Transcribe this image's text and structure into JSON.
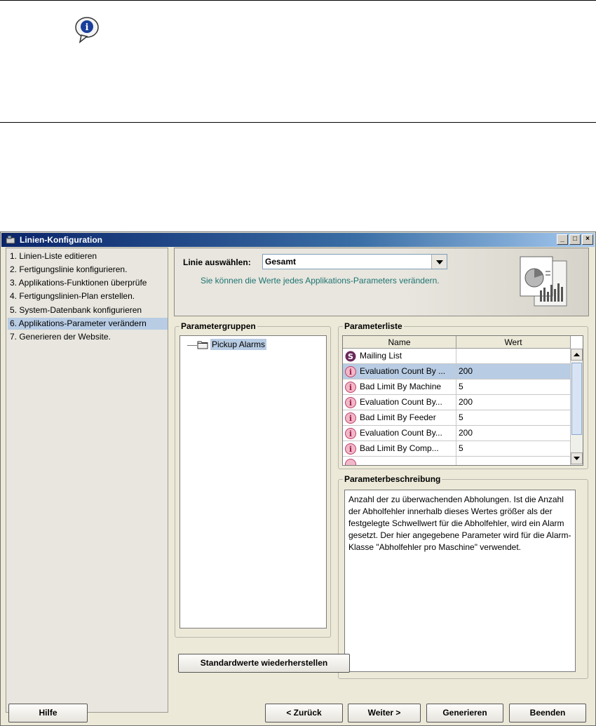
{
  "window": {
    "title": "Linien-Konfiguration",
    "minimize": "_",
    "maximize": "□",
    "close": "×"
  },
  "nav": {
    "items": [
      {
        "label": "1. Linien-Liste editieren",
        "selected": false
      },
      {
        "label": "2. Fertigungslinie konfigurieren.",
        "selected": false
      },
      {
        "label": "3. Applikations-Funktionen überprüfe",
        "selected": false
      },
      {
        "label": "4. Fertigungslinien-Plan erstellen.",
        "selected": false
      },
      {
        "label": "5. System-Datenbank konfigurieren",
        "selected": false
      },
      {
        "label": "6. Applikations-Parameter verändern",
        "selected": true
      },
      {
        "label": "7. Generieren der Website.",
        "selected": false
      }
    ]
  },
  "header": {
    "line_label": "Linie auswählen:",
    "line_value": "Gesamt",
    "description": "Sie können die Werte jedes Applikations-Parameters verändern."
  },
  "groups": {
    "title": "Parametergruppen",
    "items": [
      "Pickup Alarms"
    ]
  },
  "params": {
    "title": "Parameterliste",
    "columns": [
      "Name",
      "Wert"
    ],
    "rows": [
      {
        "icon": "S",
        "name": "Mailing List",
        "value": "",
        "selected": false
      },
      {
        "icon": "i",
        "name": "Evaluation Count By ...",
        "value": "200",
        "selected": true
      },
      {
        "icon": "i",
        "name": "Bad Limit By Machine",
        "value": "5",
        "selected": false
      },
      {
        "icon": "i",
        "name": "Evaluation Count By...",
        "value": "200",
        "selected": false
      },
      {
        "icon": "i",
        "name": "Bad Limit By Feeder",
        "value": "5",
        "selected": false
      },
      {
        "icon": "i",
        "name": "Evaluation Count By...",
        "value": "200",
        "selected": false
      },
      {
        "icon": "i",
        "name": "Bad Limit By Comp...",
        "value": "5",
        "selected": false
      }
    ]
  },
  "description": {
    "title": "Parameterbeschreibung",
    "text": "Anzahl der zu überwachenden Abholungen. Ist die Anzahl der Abholfehler innerhalb dieses Wertes größer als der festgelegte Schwellwert für die Abholfehler, wird ein Alarm gesetzt. Der hier angegebene Parameter wird für die Alarm-Klasse \"Abholfehler pro Maschine\" verwendet."
  },
  "buttons": {
    "restore": "Standardwerte wiederherstellen",
    "help": "Hilfe",
    "back": "< Zurück",
    "next": "Weiter >",
    "generate": "Generieren",
    "finish": "Beenden"
  },
  "colors": {
    "title_bar": "#0a246a",
    "selection": "#b8cce4",
    "description_text": "#1e7373",
    "icon_s": "#6a2a5a",
    "icon_i": "#c0406a"
  }
}
